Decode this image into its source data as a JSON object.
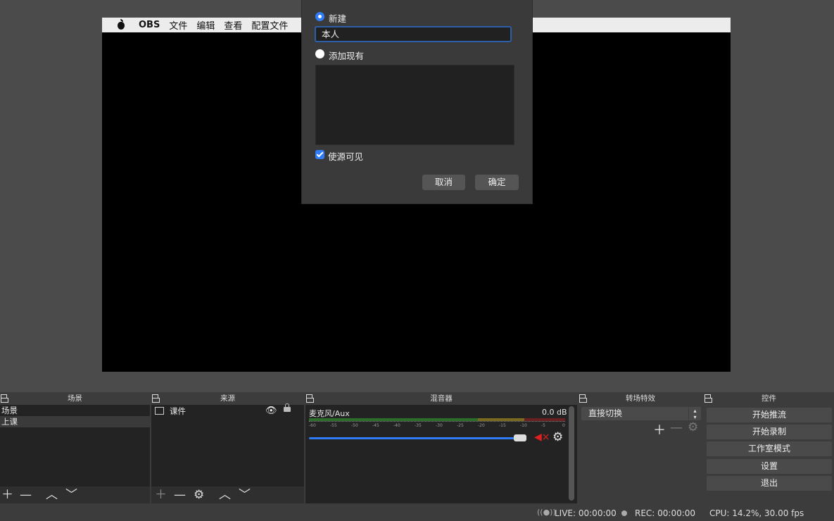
{
  "menubar": {
    "app": "OBS",
    "items": [
      "文件",
      "编辑",
      "查看",
      "配置文件"
    ]
  },
  "dialog": {
    "new_label": "新建",
    "name_value": "本人",
    "add_existing_label": "添加现有",
    "visible_label": "使源可见",
    "cancel_label": "取消",
    "ok_label": "确定"
  },
  "scenes": {
    "title": "场景",
    "items": [
      "场景",
      "上课"
    ],
    "selected_index": 1
  },
  "sources": {
    "title": "来源",
    "items": [
      "课件"
    ]
  },
  "mixer": {
    "title": "混音器",
    "channel": "麦克风/Aux",
    "db": "0.0 dB",
    "ticks": [
      "-60",
      "-55",
      "-50",
      "-45",
      "-40",
      "-35",
      "-30",
      "-25",
      "-20",
      "-15",
      "-10",
      "-5",
      "0"
    ],
    "volume_level": 0.97
  },
  "transitions": {
    "title": "转场特效",
    "selected": "直接切换"
  },
  "controls": {
    "title": "控件",
    "buttons": [
      "开始推流",
      "开始录制",
      "工作室模式",
      "设置",
      "退出"
    ]
  },
  "status": {
    "live": "LIVE: 00:00:00",
    "rec": "REC: 00:00:00",
    "cpu": "CPU: 14.2%, 30.00 fps"
  },
  "colors": {
    "accent": "#2f7cf6",
    "mute": "#e02020"
  }
}
